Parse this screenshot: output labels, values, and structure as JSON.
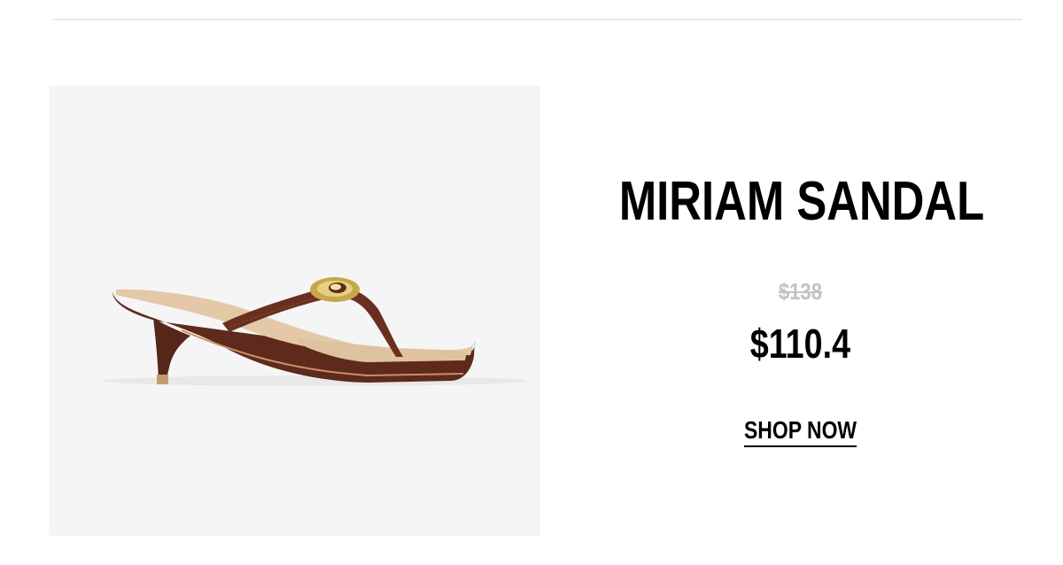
{
  "product": {
    "name": "MIRIAM SANDAL",
    "original_price": "$138",
    "sale_price": "$110.4",
    "cta_label": "SHOP NOW"
  },
  "colors": {
    "image_background": "#f5f5f5",
    "suede_brown": "#5e2a1c",
    "insole_tan": "#e3c9a8",
    "hardware_gold": "#c9a64a",
    "strikethrough_gray": "#c2c2c2",
    "text": "#000000"
  },
  "icons": {
    "product_photo": "brown-suede-kitten-heel-thong-sandal"
  }
}
